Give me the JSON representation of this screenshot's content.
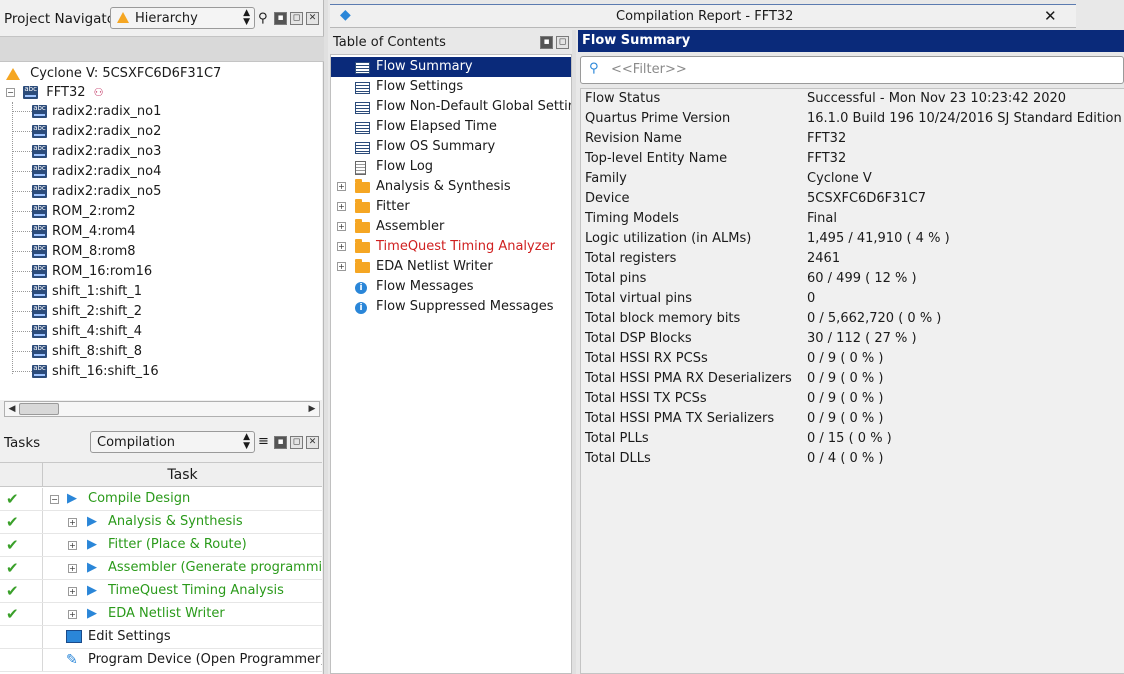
{
  "project_navigator": {
    "title": "Project Navigator",
    "view": "Hierarchy",
    "device": "Cyclone V: 5CSXFC6D6F31C7",
    "top": "FFT32",
    "instances": [
      "radix2:radix_no1",
      "radix2:radix_no2",
      "radix2:radix_no3",
      "radix2:radix_no4",
      "radix2:radix_no5",
      "ROM_2:rom2",
      "ROM_4:rom4",
      "ROM_8:rom8",
      "ROM_16:rom16",
      "shift_1:shift_1",
      "shift_2:shift_2",
      "shift_4:shift_4",
      "shift_8:shift_8",
      "shift_16:shift_16"
    ]
  },
  "tasks": {
    "title": "Tasks",
    "flow": "Compilation",
    "column": "Task",
    "rows": [
      {
        "label": "Compile Design",
        "done": true
      },
      {
        "label": "Analysis & Synthesis",
        "done": true
      },
      {
        "label": "Fitter (Place & Route)",
        "done": true
      },
      {
        "label": "Assembler (Generate programming files)",
        "done": true
      },
      {
        "label": "TimeQuest Timing Analysis",
        "done": true
      },
      {
        "label": "EDA Netlist Writer",
        "done": true
      },
      {
        "label": "Edit Settings",
        "done": false
      },
      {
        "label": "Program Device (Open Programmer)",
        "done": false
      }
    ],
    "check_glyph": "✔"
  },
  "report": {
    "title": "Compilation Report - FFT32",
    "close": "✕"
  },
  "toc": {
    "title": "Table of Contents",
    "items": [
      "Flow Summary",
      "Flow Settings",
      "Flow Non-Default Global Settings",
      "Flow Elapsed Time",
      "Flow OS Summary",
      "Flow Log",
      "Analysis & Synthesis",
      "Fitter",
      "Assembler",
      "TimeQuest Timing Analyzer",
      "EDA Netlist Writer",
      "Flow Messages",
      "Flow Suppressed Messages"
    ]
  },
  "flow_summary": {
    "title": "Flow Summary",
    "filter_placeholder": "<<Filter>>",
    "rows": [
      {
        "k": "Flow Status",
        "v": "Successful - Mon Nov 23 10:23:42 2020"
      },
      {
        "k": "Quartus Prime Version",
        "v": "16.1.0 Build 196 10/24/2016 SJ Standard Edition"
      },
      {
        "k": "Revision Name",
        "v": "FFT32"
      },
      {
        "k": "Top-level Entity Name",
        "v": "FFT32"
      },
      {
        "k": "Family",
        "v": "Cyclone V"
      },
      {
        "k": "Device",
        "v": "5CSXFC6D6F31C7"
      },
      {
        "k": "Timing Models",
        "v": "Final"
      },
      {
        "k": "Logic utilization (in ALMs)",
        "v": "1,495 / 41,910 ( 4 % )"
      },
      {
        "k": "Total registers",
        "v": "2461"
      },
      {
        "k": "Total pins",
        "v": "60 / 499 ( 12 % )"
      },
      {
        "k": "Total virtual pins",
        "v": "0"
      },
      {
        "k": "Total block memory bits",
        "v": "0 / 5,662,720 ( 0 % )"
      },
      {
        "k": "Total DSP Blocks",
        "v": "30 / 112 ( 27 % )"
      },
      {
        "k": "Total HSSI RX PCSs",
        "v": "0 / 9 ( 0 % )"
      },
      {
        "k": "Total HSSI PMA RX Deserializers",
        "v": "0 / 9 ( 0 % )"
      },
      {
        "k": "Total HSSI TX PCSs",
        "v": "0 / 9 ( 0 % )"
      },
      {
        "k": "Total HSSI PMA TX Serializers",
        "v": "0 / 9 ( 0 % )"
      },
      {
        "k": "Total PLLs",
        "v": "0 / 15 ( 0 % )"
      },
      {
        "k": "Total DLLs",
        "v": "0 / 4 ( 0 % )"
      }
    ]
  },
  "colors": {
    "selection": "#0a2a7a",
    "timequest": "#d02020",
    "task_green": "#2a9a1a",
    "check_green": "#3aa02a"
  }
}
